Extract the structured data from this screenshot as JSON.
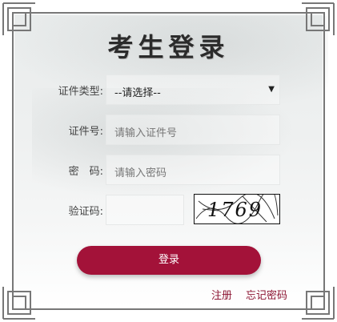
{
  "title": "考生登录",
  "form": {
    "id_type_label": "证件类型:",
    "id_type_value": "--请选择--",
    "id_number_label": "证件号:",
    "id_number_placeholder": "请输入证件号",
    "password_label": "密　码:",
    "password_placeholder": "请输入密码",
    "captcha_label": "验证码:",
    "captcha_text": "1769"
  },
  "buttons": {
    "login": "登录",
    "register": "注册",
    "forgot_password": "忘记密码"
  },
  "colors": {
    "primary": "#a31239",
    "link": "#8c1432",
    "frame": "#777777"
  }
}
